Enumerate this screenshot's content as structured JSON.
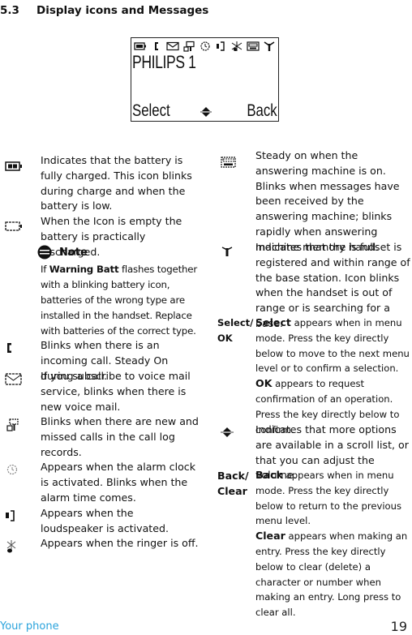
{
  "section": {
    "number": "5.3",
    "title": "Display icons and Messages"
  },
  "display": {
    "status_icons": [
      "battery-full-icon",
      "call-icon",
      "voicemail-icon",
      "call-log-icon",
      "alarm-icon",
      "loudspeaker-icon",
      "ringer-off-icon",
      "answering-machine-icon",
      "signal-antenna-icon"
    ],
    "handset_name": "PHILIPS 1",
    "soft_left": "Select",
    "soft_right": "Back",
    "center_icon": "scroll-icon"
  },
  "left_column": [
    {
      "icon": "battery-full-icon",
      "text": "Indicates that the battery is fully charged. This icon blinks during charge and when the battery is low."
    },
    {
      "icon": "battery-empty-icon",
      "text": "When the Icon is empty the battery is practically discharged."
    },
    {
      "icon": "call-icon",
      "text": "Blinks when there is an incoming call. Steady On during a call."
    },
    {
      "icon": "voicemail-icon",
      "text": "If you subscribe to voice mail service, blinks when there is new voice mail."
    },
    {
      "icon": "call-log-icon",
      "text": "Blinks when there are new and missed calls in the call log records."
    },
    {
      "icon": "alarm-icon",
      "text": "Appears when the alarm clock is activated. Blinks when the alarm time comes."
    },
    {
      "icon": "loudspeaker-icon",
      "text": "Appears when the loudspeaker is activated."
    },
    {
      "icon": "ringer-off-icon",
      "text": "Appears when the ringer is off."
    }
  ],
  "note": {
    "title": "Note",
    "prefix": "If ",
    "bold": "Warning Batt",
    "rest": " flashes together with a blinking battery icon, batteries of the wrong type are installed in the handset. Replace with batteries of the correct type."
  },
  "right_column": {
    "answering_machine": "Steady on when the answering machine is on. Blinks when messages have been received by the answering machine; blinks rapidly when answering machine memory is full.",
    "signal": "Indicates that the handset is registered and within range of the base station. Icon blinks when the handset is out of range or is searching for a base.",
    "select_ok": {
      "label_1": "Select/",
      "label_2": "OK",
      "select_bold": "Select",
      "select_rest": " appears when in menu mode. Press the key directly below to move to the next menu level or to confirm a selection.",
      "ok_bold": "OK",
      "ok_rest1": " appears to request",
      "ok_rest2": "confirmation of an operation. Press the key directly below to confirm."
    },
    "scroll": "Indicates that more options are available in a scroll list, or that you can adjust the volume.",
    "back_clear": {
      "label_1": "Back/",
      "label_2": "Clear",
      "back_bold": "Back",
      "back_rest": " appears when in menu mode. Press the key directly below to return to the previous menu level.",
      "clear_bold": "Clear",
      "clear_rest": " appears when making an entry. Press the key directly below to clear (delete) a character or number when making an entry. Long press to clear all."
    }
  },
  "footer": {
    "left": "Your phone",
    "page": "19"
  }
}
